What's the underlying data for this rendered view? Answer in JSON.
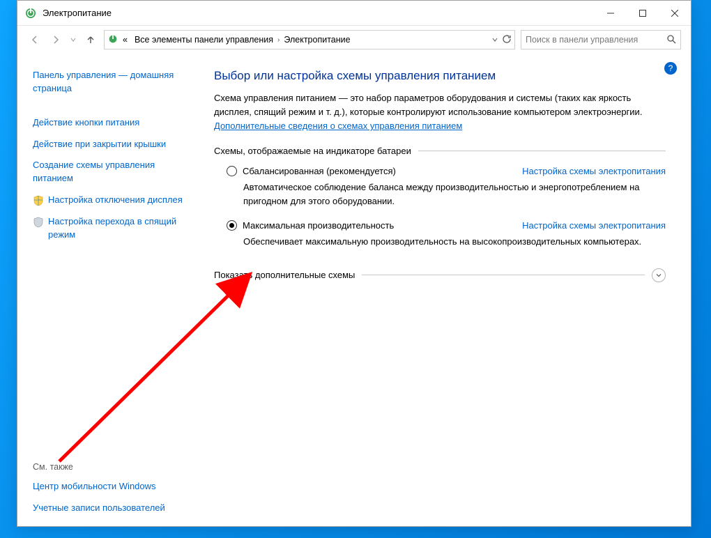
{
  "window": {
    "title": "Электропитание"
  },
  "breadcrumb": {
    "root_indicator": "«",
    "item1": "Все элементы панели управления",
    "item2": "Электропитание"
  },
  "search": {
    "placeholder": "Поиск в панели управления"
  },
  "sidebar": {
    "home": "Панель управления — домашняя страница",
    "links": [
      "Действие кнопки питания",
      "Действие при закрытии крышки",
      "Создание схемы управления питанием"
    ],
    "shielded": [
      "Настройка отключения дисплея",
      "Настройка перехода в спящий режим"
    ],
    "see_also_label": "См. также",
    "see_also": [
      "Центр мобильности Windows",
      "Учетные записи пользователей"
    ]
  },
  "main": {
    "title": "Выбор или настройка схемы управления питанием",
    "intro_text": "Схема управления питанием — это набор параметров оборудования и системы (таких как яркость дисплея, спящий режим и т. д.), которые контролируют использование компьютером электроэнергии. ",
    "intro_link": "Дополнительные сведения о схемах управления питанием",
    "group_label": "Схемы, отображаемые на индикаторе батареи",
    "plans": [
      {
        "name": "Сбалансированная (рекомендуется)",
        "selected": false,
        "settings_link": "Настройка схемы электропитания",
        "desc": "Автоматическое соблюдение баланса между производительностью и энергопотреблением на пригодном для этого оборудовании."
      },
      {
        "name": "Максимальная производительность",
        "selected": true,
        "settings_link": "Настройка схемы электропитания",
        "desc": "Обеспечивает максимальную производительность на высокопроизводительных компьютерах."
      }
    ],
    "expander_label": "Показать дополнительные схемы"
  },
  "colors": {
    "link": "#0066cc",
    "heading": "#003399"
  }
}
